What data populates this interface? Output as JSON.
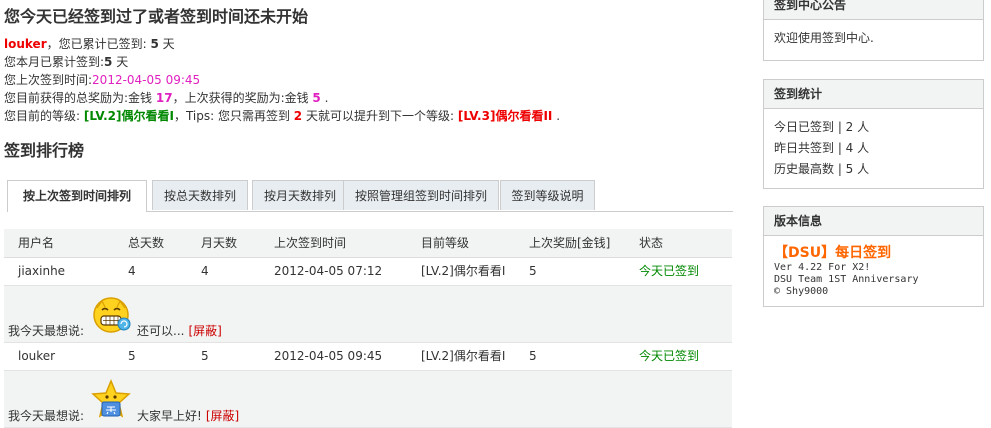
{
  "header": {
    "title": "您今天已经签到过了或者签到时间还未开始"
  },
  "info": {
    "line1": {
      "user": "louker",
      "text": "，您已累计已签到: ",
      "days": "5",
      "unit": " 天"
    },
    "line2": {
      "text": "您本月已累计签到:",
      "days": "5",
      "unit": " 天"
    },
    "line3": {
      "text": "您上次签到时间:",
      "time": "2012-04-05 09:45"
    },
    "line4": {
      "text": "您目前获得的总奖励为:金钱 ",
      "total": "17",
      "mid": "，上次获得的奖励为:金钱 ",
      "last": "5",
      "end": " ."
    },
    "line5": {
      "text": "您目前的等级: ",
      "level": "[LV.2]偶尔看看I",
      "mid": "，Tips: 您只需再签到 ",
      "need": "2",
      "mid2": " 天就可以提升到下一个等级: ",
      "next": "[LV.3]偶尔看看II",
      "end": " ."
    }
  },
  "ranking": {
    "title": "签到排行榜",
    "tabs": [
      "按上次签到时间排列",
      "按总天数排列",
      "按月天数排列",
      "按照管理组签到时间排列",
      "签到等级说明"
    ],
    "columns": [
      "用户名",
      "总天数",
      "月天数",
      "上次签到时间",
      "目前等级",
      "上次奖励[金钱]",
      "状态"
    ],
    "rows": [
      {
        "user": "jiaxinhe",
        "total": "4",
        "month": "4",
        "time": "2012-04-05 07:12",
        "level": "[LV.2]偶尔看看I",
        "reward": "5",
        "status": "今天已签到",
        "mood_label": "我今天最想说:",
        "mood_text": "还可以...",
        "block": "[屏蔽]"
      },
      {
        "user": "louker",
        "total": "5",
        "month": "5",
        "time": "2012-04-05 09:45",
        "level": "[LV.2]偶尔看看I",
        "reward": "5",
        "status": "今天已签到",
        "mood_label": "我今天最想说:",
        "mood_text": "大家早上好!",
        "block": "[屏蔽]"
      }
    ]
  },
  "sidebar": {
    "notice": {
      "title": "签到中心公告",
      "body": "欢迎使用签到中心."
    },
    "stats": {
      "title": "签到统计",
      "items": [
        "今日已签到 | 2 人",
        "昨日共签到 | 4 人",
        "历史最高数 | 5 人"
      ]
    },
    "version": {
      "title": "版本信息",
      "product": "【DSU】每日签到",
      "lines": [
        "Ver 4.22 For X2!",
        "DSU Team 1ST Anniversary",
        "© Shy9000"
      ]
    }
  },
  "colors": {
    "accent_red": "#ee0000",
    "magenta": "#e020c0",
    "green": "#008800",
    "dsu_orange": "#ff6600"
  }
}
